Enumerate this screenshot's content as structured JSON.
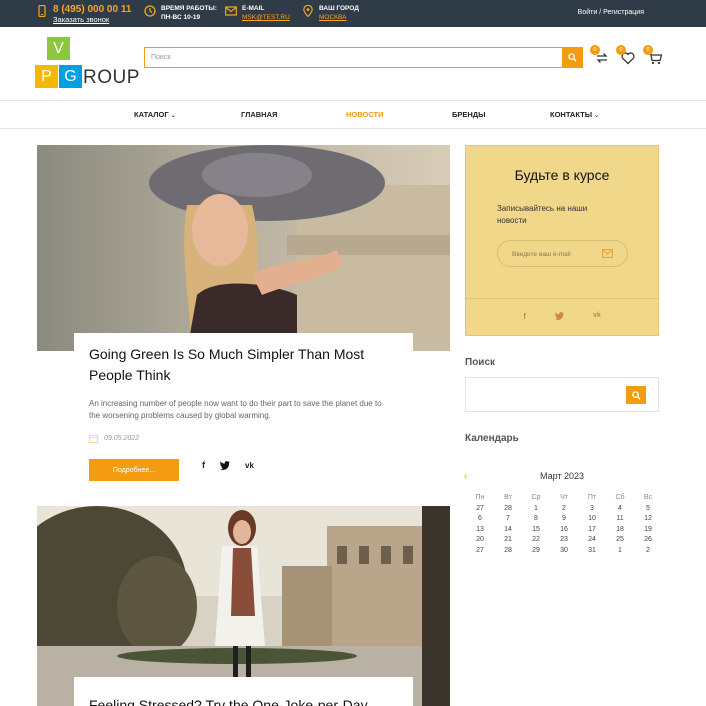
{
  "topbar": {
    "phone": "8 (495) 000 00 11",
    "callback": "Заказать звонок",
    "hours_label": "ВРЕМЯ РАБОТЫ:",
    "hours_value": "ПН-ВС 10-19",
    "email_label": "E-MAIL",
    "email_value": "MSK@TEST.RU",
    "city_label": "ВАШ ГОРОД",
    "city_value": "МОСКВА",
    "auth": "Войти / Регистрация"
  },
  "logo": {
    "v": "V",
    "p": "P",
    "g": "G",
    "rest": "ROUP"
  },
  "search": {
    "placeholder": "Поиск"
  },
  "header_icons": {
    "compare_count": "0",
    "wishlist_count": "0",
    "cart_count": "0"
  },
  "nav": {
    "items": [
      {
        "label": "КАТАЛОГ"
      },
      {
        "label": "ГЛАВНАЯ"
      },
      {
        "label": "НОВОСТИ"
      },
      {
        "label": "БРЕНДЫ"
      },
      {
        "label": "КОНТАКТЫ"
      }
    ]
  },
  "articles": [
    {
      "title": "Going Green Is So Much Simpler Than Most People Think",
      "excerpt": "An increasing number of people now want to do their part to save the planet due to the worsening problems caused by global warming.",
      "date": "09.05.2022",
      "more": "Подробнее..."
    },
    {
      "title": "Feeling Stressed? Try the One-Joke-per-Day"
    }
  ],
  "subscribe": {
    "title": "Будьте в курсе",
    "text": "Записывайтесь на наши новости",
    "email_placeholder": "Введите ваш e-mail"
  },
  "sidebar": {
    "search_title": "Поиск",
    "calendar_title": "Календарь"
  },
  "calendar": {
    "month": "Март 2023",
    "weekdays": [
      "Пн",
      "Вт",
      "Ср",
      "Чт",
      "Пт",
      "Сб",
      "Вс"
    ],
    "weeks": [
      [
        "27",
        "28",
        "1",
        "2",
        "3",
        "4",
        "5"
      ],
      [
        "6",
        "7",
        "8",
        "9",
        "10",
        "11",
        "12"
      ],
      [
        "13",
        "14",
        "15",
        "16",
        "17",
        "18",
        "19"
      ],
      [
        "20",
        "21",
        "22",
        "23",
        "24",
        "25",
        "26"
      ],
      [
        "27",
        "28",
        "29",
        "30",
        "31",
        "1",
        "2"
      ]
    ]
  },
  "colors": {
    "accent": "#f39c12",
    "topbar": "#2f3b46",
    "subscribe_bg": "#f0d78a"
  }
}
